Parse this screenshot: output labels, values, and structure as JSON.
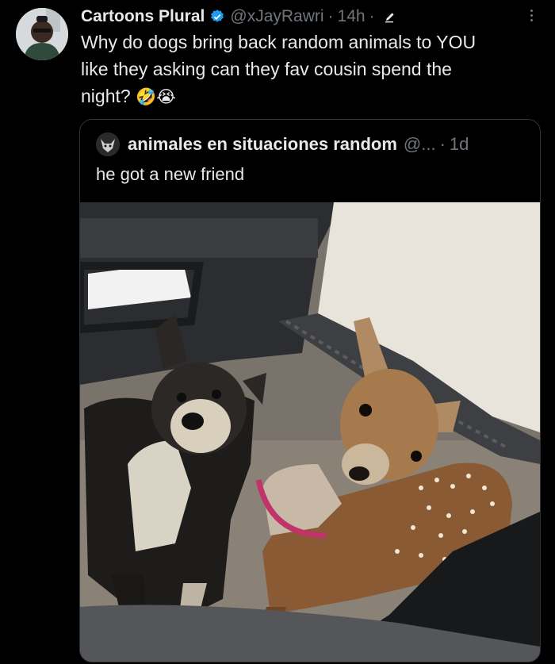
{
  "tweet": {
    "display_name": "Cartoons Plural",
    "handle": "@xJayRawri",
    "separator": "·",
    "time": "14h",
    "line1": "Why do dogs bring back random animals to YOU",
    "line2": "like they asking can they fav cousin spend the",
    "line3": "night?",
    "emoji1": "🤣",
    "emoji2": "😭",
    "icons": [
      "verified-badge-icon",
      "edit-pencil-icon",
      "more-options-icon"
    ]
  },
  "quote": {
    "display_name": "animales en situaciones random",
    "handle": "@...",
    "separator": "·",
    "time": "1d",
    "text": "he got a new friend"
  },
  "colors": {
    "background": "#000000",
    "primary_text": "#e7e9ea",
    "secondary_text": "#71767b",
    "verified_blue": "#1d9bf0",
    "border": "#2f3336"
  }
}
